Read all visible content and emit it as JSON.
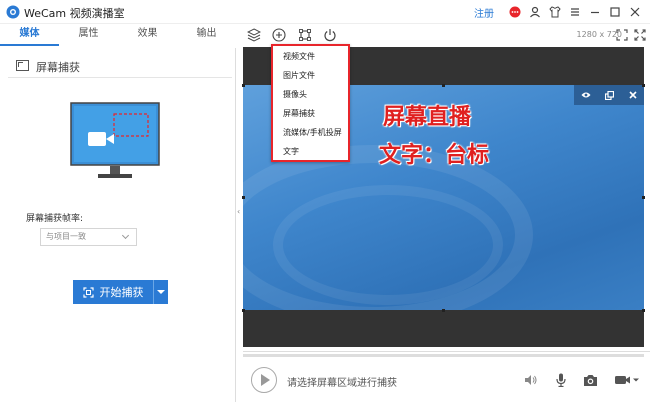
{
  "app": {
    "title": "WeCam 视频演播室",
    "login": "注册"
  },
  "tabs": [
    {
      "label": "媒体",
      "active": true
    },
    {
      "label": "属性",
      "active": false
    },
    {
      "label": "效果",
      "active": false
    },
    {
      "label": "输出",
      "active": false
    }
  ],
  "toolbar": {
    "resolution": "1280 x 720"
  },
  "left_panel": {
    "title": "屏幕捕获",
    "fps_label": "屏幕捕获帧率:",
    "fps_value": "与项目一致",
    "capture_button": "开始捕获"
  },
  "dropdown": {
    "items": [
      "视频文件",
      "图片文件",
      "摄像头",
      "屏幕捕获",
      "流媒体/手机投屏",
      "文字"
    ]
  },
  "preview": {
    "text_line1": "屏幕直播",
    "text_line2": "文字：台标"
  },
  "bottom": {
    "hint": "请选择屏幕区域进行捕获"
  },
  "colors": {
    "accent": "#2a7ad4",
    "highlight_border": "#e8252b",
    "text_red": "#e02020"
  }
}
